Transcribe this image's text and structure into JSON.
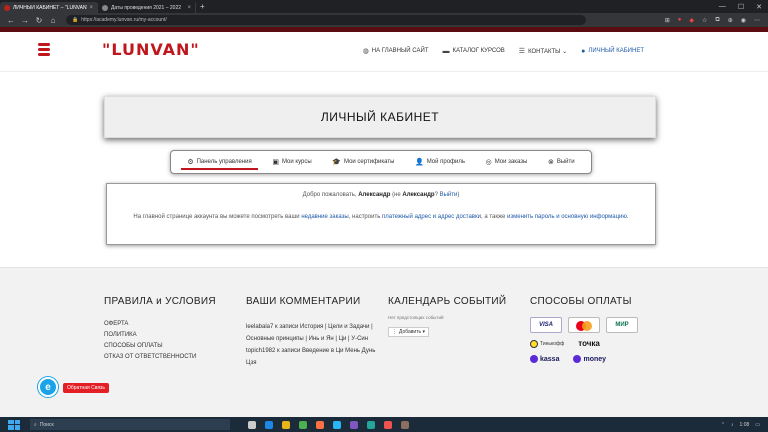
{
  "browser": {
    "tabs": [
      {
        "label": "ЛИЧНЫЙ КАБИНЕТ – \"LUNVAN\"",
        "active": true
      },
      {
        "label": "Даты проведения 2021 – 2022",
        "active": false
      }
    ],
    "url": "https://academy.lunvan.ru/my-account/"
  },
  "header": {
    "logo": "\"LUNVAN\"",
    "nav": [
      {
        "label": "НА ГЛАВНЫЙ САЙТ",
        "icon": "globe-icon"
      },
      {
        "label": "КАТАЛОГ КУРСОВ",
        "icon": "folder-icon"
      },
      {
        "label": "КОНТАКТЫ ⌄",
        "icon": "list-icon"
      },
      {
        "label": "ЛИЧНЫЙ КАБИНЕТ",
        "icon": "user-icon"
      }
    ]
  },
  "page": {
    "title": "ЛИЧНЫЙ КАБИНЕТ"
  },
  "account_tabs": [
    {
      "label": "Панель управления",
      "icon": "gear-icon",
      "active": true
    },
    {
      "label": "Мои курсы",
      "icon": "monitor-icon",
      "active": false
    },
    {
      "label": "Мои сертификаты",
      "icon": "graduation-cap-icon",
      "active": false
    },
    {
      "label": "Мой профиль",
      "icon": "user-icon",
      "active": false
    },
    {
      "label": "Мои заказы",
      "icon": "orders-icon",
      "active": false
    },
    {
      "label": "Выйти",
      "icon": "close-circle-icon",
      "active": false
    }
  ],
  "content": {
    "greeting_prefix": "Добро пожаловать,",
    "user_name": "Александр",
    "greeting_mid": "(не",
    "greeting_name2": "Александр",
    "greeting_q": "?",
    "logout_link": "Выйти",
    "greeting_end": ")",
    "desc_1": "На главной странице аккаунта вы можете посмотреть ваши",
    "desc_link1": "недавние заказы",
    "desc_2": ", настроить",
    "desc_link2": "платежный адрес и адрес доставки",
    "desc_3": ", а также",
    "desc_link3": "изменить пароль и основную информацию",
    "desc_4": "."
  },
  "footer": {
    "rules_title": "ПРАВИЛА и УСЛОВИЯ",
    "rules_items": [
      "ОФЕРТА",
      "ПОЛИТИКА",
      "СПОСОБЫ ОПЛАТЫ",
      "ОТКАЗ ОТ ОТВЕТСТВЕННОСТИ"
    ],
    "comments_title": "ВАШИ КОММЕНТАРИИ",
    "comment_1": "leelabala7 к записи История | Цели и Задачи | Основные принципы | Инь и Ян | Ци | У-Син",
    "comment_2": "topich1982 к записи Введение в Ци Мень Дунь Цзя",
    "calendar_title": "КАЛЕНДАРЬ СОБЫТИЙ",
    "calendar_label": "Нет предстоящих событий",
    "calendar_button": "Добавить ▾",
    "payments_title": "СПОСОБЫ ОПЛАТЫ",
    "payments": {
      "visa": "VISA",
      "mir": "МИР",
      "tinkoff": "Тинькофф",
      "tochka": "точка",
      "kassa": "kassa",
      "money": "money"
    }
  },
  "widgets": {
    "callback_label": "Обратная Связь",
    "chat_letter": "e"
  },
  "taskbar": {
    "search": "Поиск",
    "time": "1:08"
  }
}
